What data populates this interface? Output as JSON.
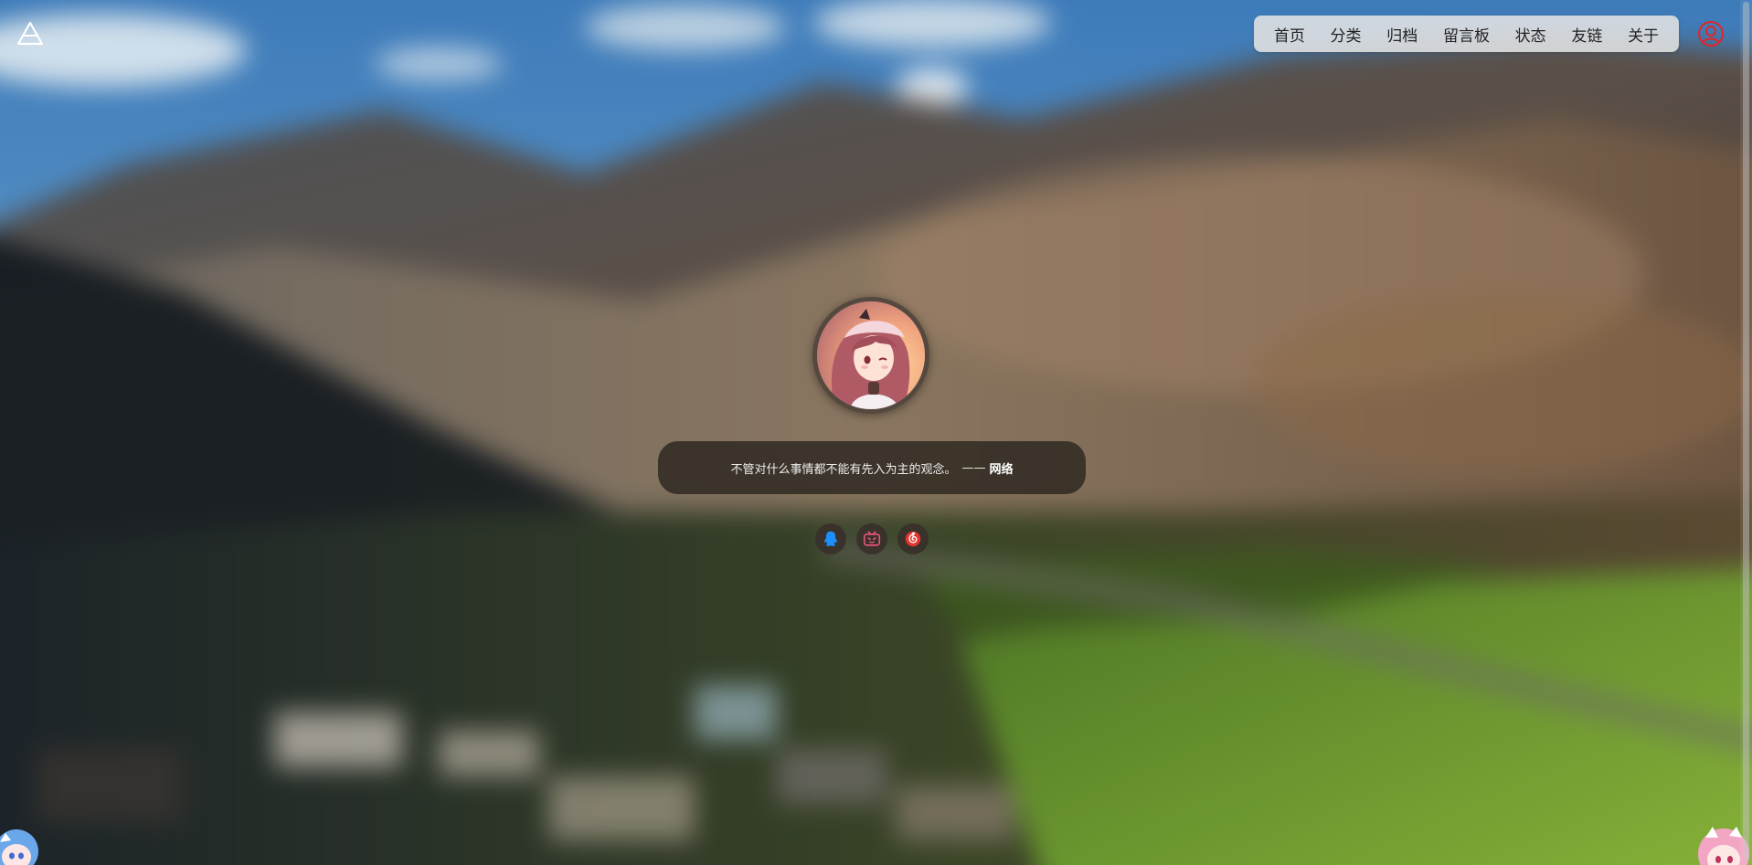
{
  "nav": {
    "items": [
      {
        "label": "首页"
      },
      {
        "label": "分类"
      },
      {
        "label": "归档"
      },
      {
        "label": "留言板"
      },
      {
        "label": "状态"
      },
      {
        "label": "友链"
      },
      {
        "label": "关于"
      }
    ]
  },
  "quote": {
    "text": "不管对什么事情都不能有先入为主的观念。",
    "dash": "——",
    "author": "网络"
  },
  "social": [
    {
      "icon": "qq-icon",
      "color": "#1e8fff"
    },
    {
      "icon": "bilibili-icon",
      "color": "#e8537a"
    },
    {
      "icon": "netease-music-icon",
      "color": "#e3352d"
    }
  ],
  "colors": {
    "nav_bg": "#e2e2e2",
    "user_icon": "#e3242b",
    "quote_bg": "#28221c"
  }
}
